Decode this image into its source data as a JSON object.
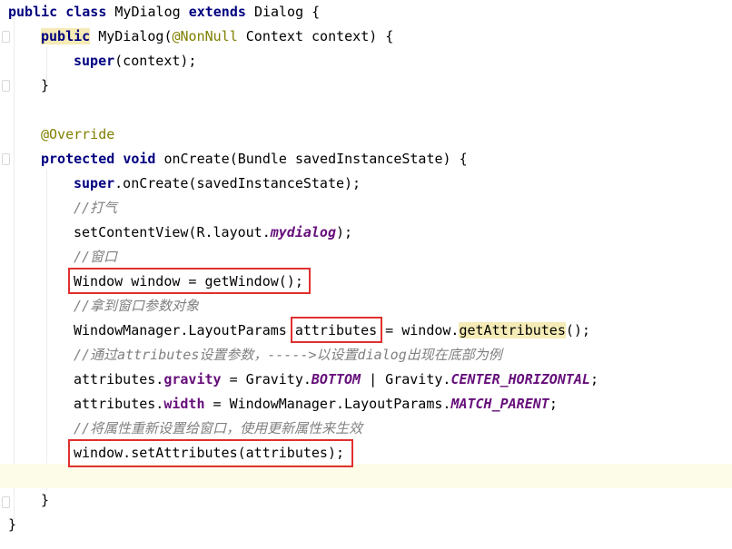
{
  "code": {
    "class_decl": {
      "kw_public": "public",
      "kw_class": "class",
      "name": "MyDialog",
      "kw_extends": "extends",
      "parent": "Dialog",
      "open": "{"
    },
    "ctor": {
      "kw_public": "public",
      "name": "MyDialog",
      "paren_open": "(",
      "annotation": "@NonNull",
      "params": " Context context) {"
    },
    "super_call": {
      "kw_super": "super",
      "args": "(context);"
    },
    "close_brace": "}",
    "override": "@Override",
    "on_create": {
      "kw_protected": "protected",
      "kw_void": "void",
      "rest": "onCreate(Bundle savedInstanceState) {"
    },
    "super_on_create": {
      "kw_super": "super",
      "rest": ".onCreate(savedInstanceState);"
    },
    "comment_1": "//打气",
    "set_content": {
      "prefix": "setContentView(R.layout.",
      "field": "mydialog",
      "suffix": ");"
    },
    "comment_2": "//窗口",
    "window_line": "Window window = getWindow();",
    "comment_3": "//拿到窗口参数对象",
    "attrs_line": {
      "prefix": "WindowManager.LayoutParams ",
      "var": "attributes",
      "middle": " = window.",
      "method": "getAttributes",
      "suffix": "();"
    },
    "comment_4": "//通过attributes设置参数，----->以设置dialog出现在底部为例",
    "gravity_line": {
      "prefix": "attributes.",
      "field": "gravity",
      "middle": " = Gravity.",
      "const1": "BOTTOM",
      "pipe": " | Gravity.",
      "const2": "CENTER_HORIZONTAL",
      "suffix": ";"
    },
    "width_line": {
      "prefix": "attributes.",
      "field": "width",
      "middle": " = WindowManager.LayoutParams.",
      "const": "MATCH_PARENT",
      "suffix": ";"
    },
    "comment_5": "//将属性重新设置给窗口，使用更新属性来生效",
    "set_attrs_line": "window.setAttributes(attributes);"
  },
  "colors": {
    "keyword": "#000080",
    "annotation": "#808000",
    "field": "#660e7a",
    "comment": "#808080",
    "highlight_box": "#e03030",
    "current_line": "#fdfce8"
  }
}
